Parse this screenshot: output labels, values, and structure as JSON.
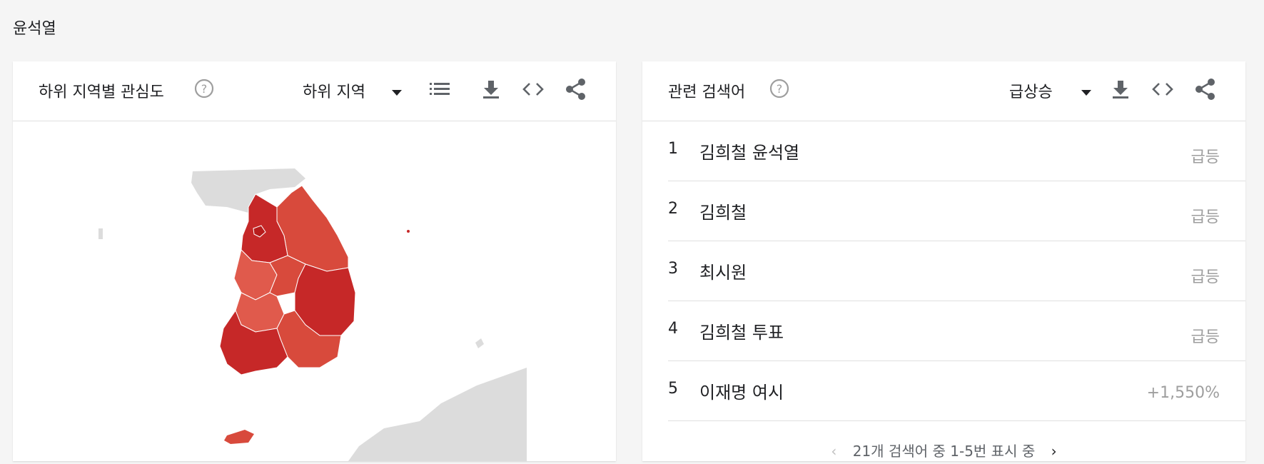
{
  "page": {
    "title": "윤석열"
  },
  "left_card": {
    "title": "하위 지역별 관심도",
    "region_select": "하위 지역",
    "icons": [
      "help-icon",
      "dropdown-icon",
      "list-icon",
      "download-icon",
      "embed-icon",
      "share-icon"
    ],
    "map_colors": {
      "high": "#c62828",
      "mid": "#d84a3c",
      "low": "#e05a4c",
      "land": "#dcdcdc"
    }
  },
  "right_card": {
    "title": "관련 검색어",
    "filter_select": "급상승",
    "rows": [
      {
        "rank": "1",
        "term": "김희철 윤석열",
        "value": "급등"
      },
      {
        "rank": "2",
        "term": "김희철",
        "value": "급등"
      },
      {
        "rank": "3",
        "term": "최시원",
        "value": "급등"
      },
      {
        "rank": "4",
        "term": "김희철 투표",
        "value": "급등"
      },
      {
        "rank": "5",
        "term": "이재명 여시",
        "value": "+1,550%"
      }
    ],
    "pager_text": "21개 검색어 중 1-5번 표시 중"
  }
}
